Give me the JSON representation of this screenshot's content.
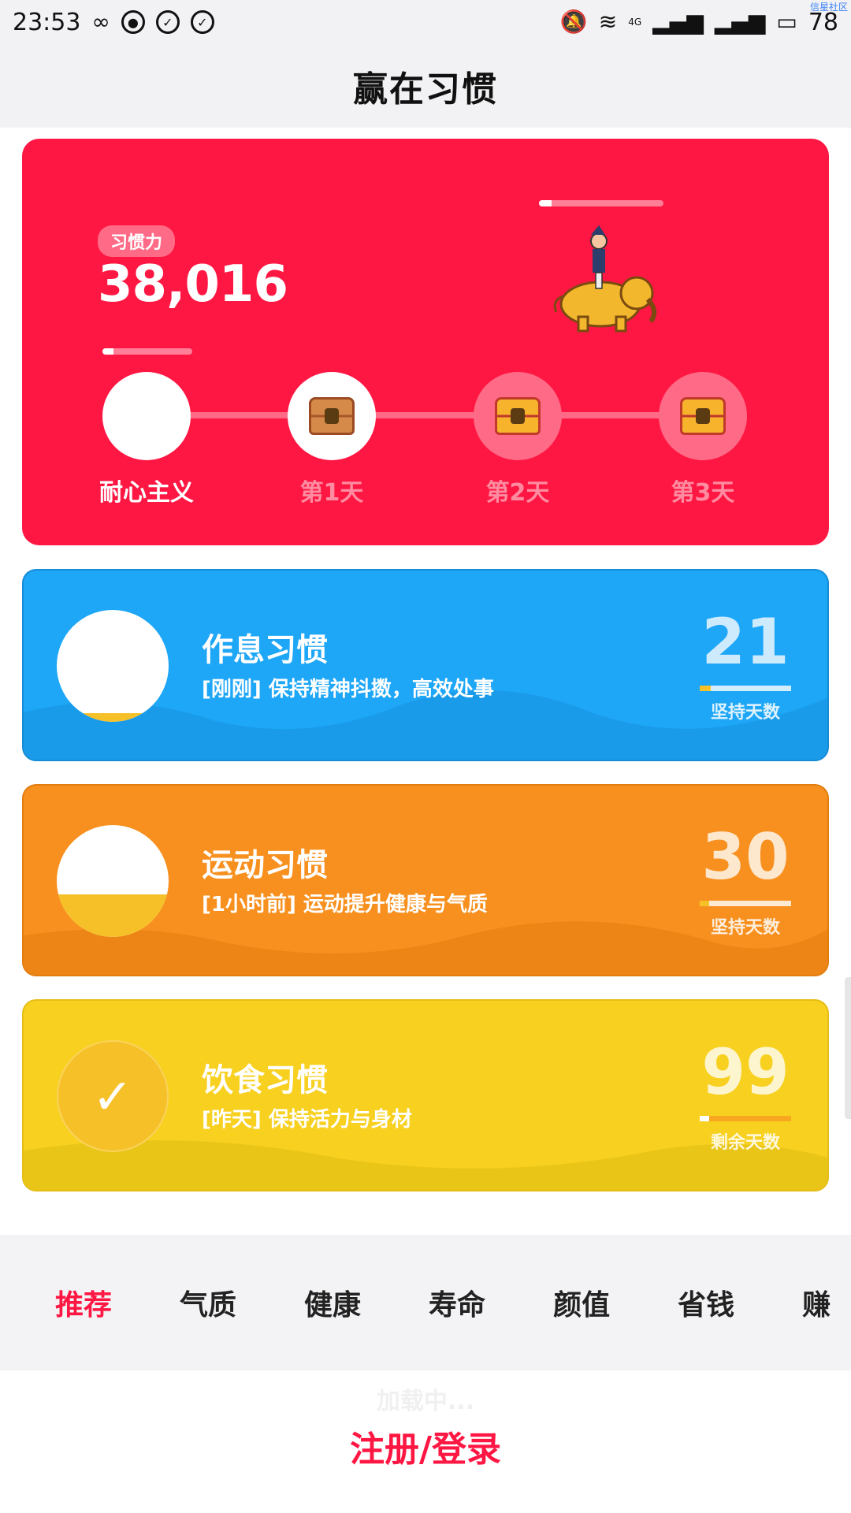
{
  "status_bar": {
    "time": "23:53",
    "battery": "78",
    "network": "4G",
    "corner_tag": "信星社区"
  },
  "header": {
    "title": "赢在习惯"
  },
  "habit_force": {
    "badge": "习惯力",
    "value": "38,016",
    "progress_small": 0.12,
    "progress_top": 0.1,
    "nodes": [
      {
        "label": "耐心主义",
        "state": "current"
      },
      {
        "label": "第1天",
        "state": "open"
      },
      {
        "label": "第2天",
        "state": "locked"
      },
      {
        "label": "第3天",
        "state": "locked"
      }
    ]
  },
  "habits": [
    {
      "name": "作息习惯",
      "subtitle": "[刚刚] 保持精神抖擞，高效处事",
      "number": "21",
      "number_label": "坚持天数",
      "fill_level": 0.08,
      "bar_progress": 0.12,
      "color": "#1ea6f7"
    },
    {
      "name": "运动习惯",
      "subtitle": "[1小时前] 运动提升健康与气质",
      "number": "30",
      "number_label": "坚持天数",
      "fill_level": 0.38,
      "bar_progress": 0.1,
      "color": "#f7901e"
    },
    {
      "name": "饮食习惯",
      "subtitle": "[昨天] 保持活力与身材",
      "number": "99",
      "number_label": "剩余天数",
      "checked": true,
      "bar_progress": 0.1,
      "color": "#f7d020"
    }
  ],
  "tabs": [
    {
      "label": "推荐",
      "active": true
    },
    {
      "label": "气质"
    },
    {
      "label": "健康"
    },
    {
      "label": "寿命"
    },
    {
      "label": "颜值"
    },
    {
      "label": "省钱"
    },
    {
      "label": "赚"
    }
  ],
  "loading_text": "加载中...",
  "login_label": "注册/登录"
}
